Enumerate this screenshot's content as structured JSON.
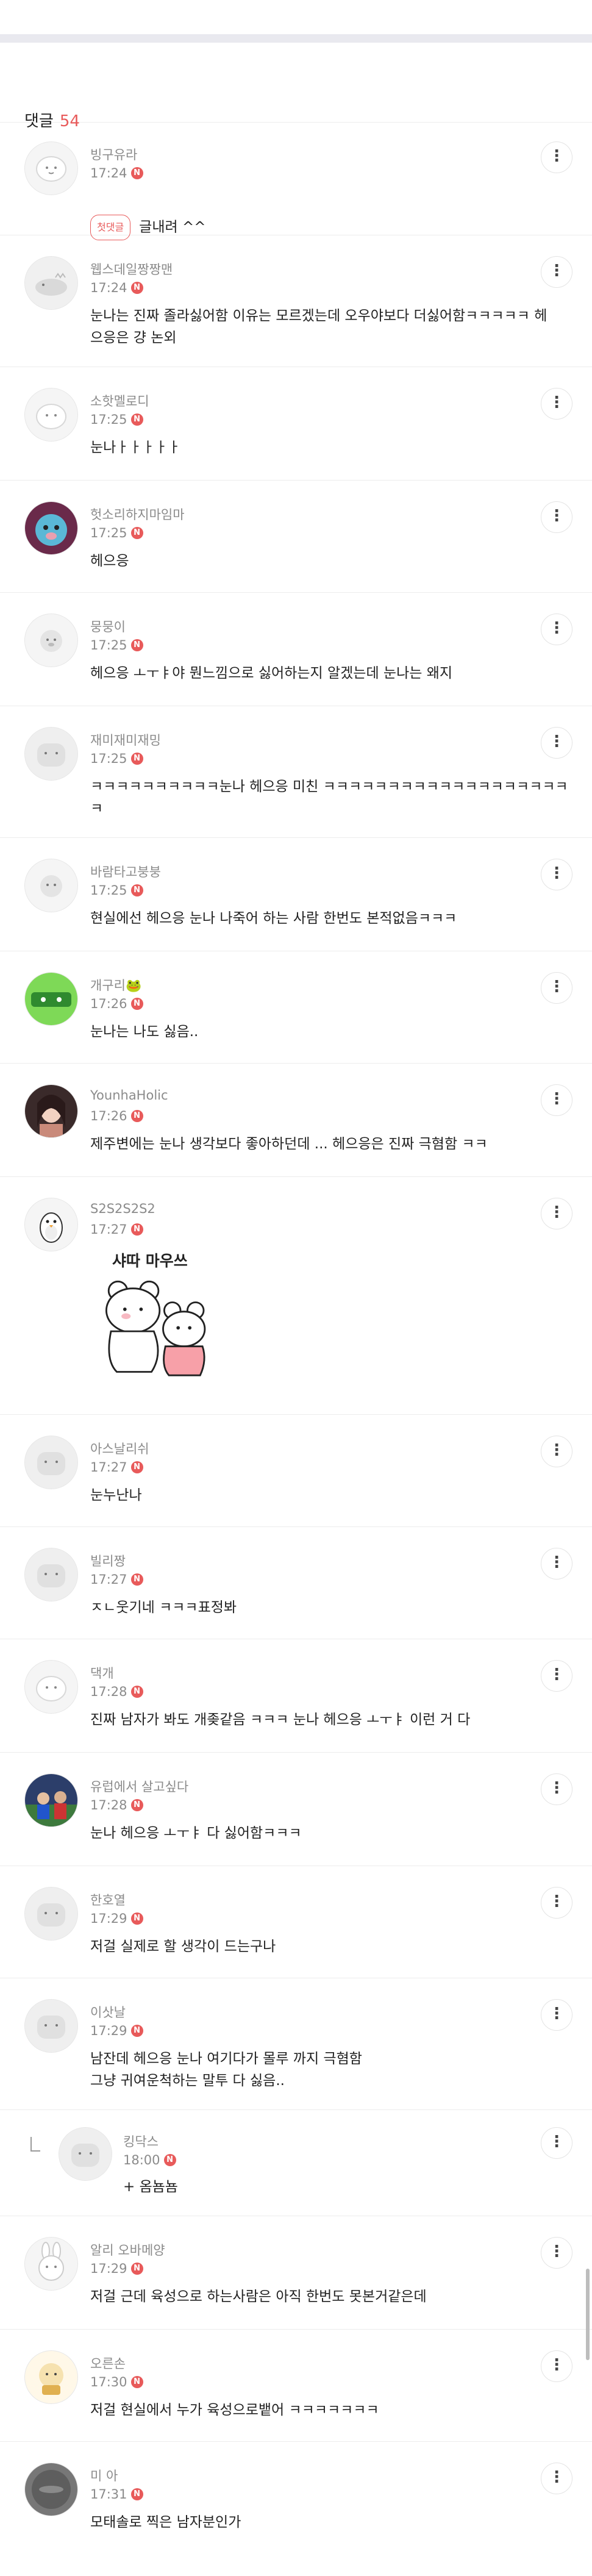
{
  "header": {
    "title": "댓글",
    "count": "54"
  },
  "comments": [
    {
      "nickname": "빙구유라",
      "time": "17:24",
      "text": "글내려 ^^",
      "first_badge": "첫댓글"
    },
    {
      "nickname": "웹스데일짱짱맨",
      "time": "17:24",
      "text": "눈나는 진짜 졸라싫어함 이유는 모르겠는데 오우야보다 더싫어함ㅋㅋㅋㅋㅋ 헤\n으응은 걍 논외"
    },
    {
      "nickname": "소핫멜로디",
      "time": "17:25",
      "text": "눈나ㅏㅏㅏㅏㅏ"
    },
    {
      "nickname": "헛소리하지마임마",
      "time": "17:25",
      "text": "헤으응"
    },
    {
      "nickname": "뭉뭉이",
      "time": "17:25",
      "text": "헤으응 ㅗㅜㅑ야 뭔느낌으로 싫어하는지 알겠는데 눈나는 왜지"
    },
    {
      "nickname": "재미재미재밍",
      "time": "17:25",
      "text": "ㅋㅋㅋㅋㅋㅋㅋㅋㅋㅋ눈나 헤으응 미친 ㅋㅋㅋㅋㅋㅋㅋㅋㅋㅋㅋㅋㅋㅋㅋㅋㅋㅋㅋ\nㅋ"
    },
    {
      "nickname": "바람타고붕붕",
      "time": "17:25",
      "text": "현실에선 헤으응 눈나 나죽어 하는 사람 한번도 본적없음ㅋㅋㅋ"
    },
    {
      "nickname": "개구리🐸",
      "time": "17:26",
      "text": "눈나는 나도 싫음.."
    },
    {
      "nickname": "YounhaHolic",
      "time": "17:26",
      "text": "제주변에는 눈나 생각보다 좋아하던데 ... 헤으응은 진짜 극혐함 ㅋㅋ"
    },
    {
      "nickname": "S2S2S2S2",
      "time": "17:27",
      "text": "",
      "sticker_text": "샤따 마우쓰"
    },
    {
      "nickname": "아스날리쉬",
      "time": "17:27",
      "text": "눈누난나"
    },
    {
      "nickname": "빌리짱",
      "time": "17:27",
      "text": "ㅈㄴ웃기네 ㅋㅋㅋ표정봐"
    },
    {
      "nickname": "댁개",
      "time": "17:28",
      "text": "진짜 남자가 봐도 개좆같음 ㅋㅋㅋ 눈나 헤으응 ㅗㅜㅑ 이런 거 다"
    },
    {
      "nickname": "유럽에서 살고싶다",
      "time": "17:28",
      "text": "눈나 헤으응 ㅗㅜㅑ 다 싫어함ㅋㅋㅋ"
    },
    {
      "nickname": "한호열",
      "time": "17:29",
      "text": "저걸 실제로 할 생각이 드는구나"
    },
    {
      "nickname": "이삿날",
      "time": "17:29",
      "text": "남잔데 헤으응 눈나 여기다가 몰루 까지 극혐함\n그냥 귀여운척하는 말투 다 싫음.."
    },
    {
      "nickname": "킹닥스",
      "time": "18:00",
      "text": "+ 옴뇸뇸",
      "reply": true
    },
    {
      "nickname": "알리 오바메양",
      "time": "17:29",
      "text": "저걸 근데 육성으로 하는사람은 아직 한번도 못본거같은데"
    },
    {
      "nickname": "오른손",
      "time": "17:30",
      "text": "저걸 현실에서 누가 육성으로뱉어 ㅋㅋㅋㅋㅋㅋㅋ"
    },
    {
      "nickname": "미 아",
      "time": "17:31",
      "text": "모태솔로 찍은 남자분인가"
    }
  ],
  "ui": {
    "new_badge": "N",
    "more": "⋮"
  }
}
